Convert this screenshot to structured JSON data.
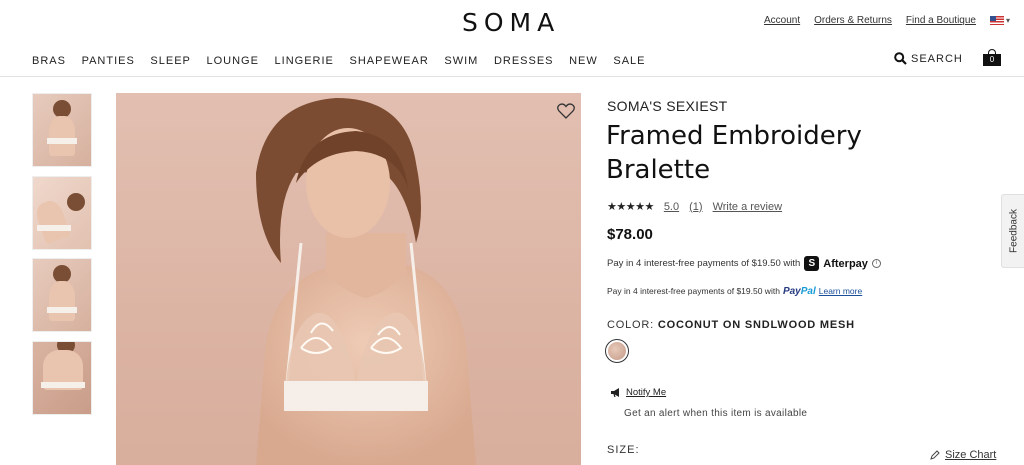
{
  "brand": {
    "logo": "SOMA"
  },
  "utility": {
    "account": "Account",
    "orders": "Orders & Returns",
    "boutique": "Find a Boutique",
    "locale_icon": "us-flag-icon"
  },
  "nav": [
    "BRAS",
    "PANTIES",
    "SLEEP",
    "LOUNGE",
    "LINGERIE",
    "SHAPEWEAR",
    "SWIM",
    "DRESSES",
    "NEW",
    "SALE"
  ],
  "header": {
    "search_label": "SEARCH",
    "cart_count": "0"
  },
  "product": {
    "eyebrow": "SOMA'S SEXIEST",
    "title": "Framed Embroidery Bralette",
    "stars": "★★★★★",
    "rating": "5.0",
    "review_count": "(1)",
    "write_review": "Write a review",
    "price": "$78.00"
  },
  "payments": {
    "afterpay_text": "Pay in 4 interest-free payments of $19.50 with",
    "afterpay_brand": "Afterpay",
    "afterpay_icon": "S",
    "info_icon": "i",
    "paypal_text": "Pay in 4 interest-free payments of $19.50 with",
    "paypal_brand_1": "Pay",
    "paypal_brand_2": "Pal",
    "learn_more": "Learn more"
  },
  "color": {
    "label": "COLOR:",
    "value": "COCONUT ON SNDLWOOD MESH"
  },
  "notify": {
    "link": "Notify Me",
    "alert": "Get an alert when this item is available"
  },
  "size": {
    "label": "SIZE:",
    "chart": "Size Chart"
  },
  "feedback": "Feedback",
  "colors": {
    "text": "#222222",
    "accent_paypal_dark": "#253b80",
    "accent_paypal_light": "#179bd7",
    "image_bg": "#dcb4a4"
  }
}
